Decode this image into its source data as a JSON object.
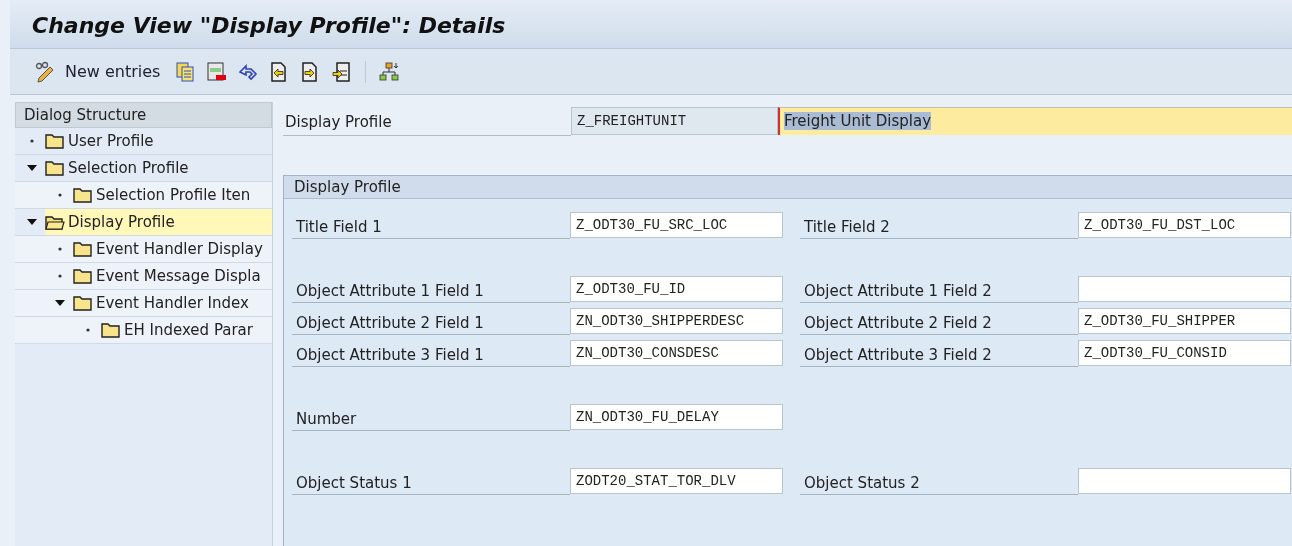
{
  "window": {
    "title": "Change View \"Display Profile\": Details"
  },
  "toolbar": {
    "items": [
      {
        "kind": "glasses-pencil"
      },
      {
        "kind": "text",
        "label": "New entries"
      },
      {
        "kind": "copy"
      },
      {
        "kind": "delete"
      },
      {
        "kind": "undo"
      },
      {
        "kind": "previous"
      },
      {
        "kind": "next"
      },
      {
        "kind": "last"
      },
      {
        "kind": "separator"
      },
      {
        "kind": "hierarchy"
      }
    ]
  },
  "dialog_structure": {
    "title": "Dialog Structure",
    "items": [
      {
        "label": "User Profile",
        "selected": false
      },
      {
        "label": "Selection Profile",
        "selected": false,
        "expanded": true,
        "children": [
          {
            "label": "Selection Profile Iten",
            "selected": false
          }
        ]
      },
      {
        "label": "Display Profile",
        "selected": true,
        "expanded": true,
        "children": [
          {
            "label": "Event Handler Display",
            "selected": false
          },
          {
            "label": "Event Message Displa",
            "selected": false
          },
          {
            "label": "Event Handler Index",
            "selected": false,
            "expanded": true,
            "children": [
              {
                "label": "EH Indexed Parar",
                "selected": false
              }
            ]
          }
        ]
      }
    ]
  },
  "header": {
    "label": "Display Profile",
    "key": "Z_FREIGHTUNIT",
    "description": "Freight Unit Display"
  },
  "section": {
    "title": "Display Profile",
    "groups": [
      [
        [
          {
            "label": "Title Field 1",
            "value": "Z_ODT30_FU_SRC_LOC"
          },
          {
            "label": "Title Field 2",
            "value": "Z_ODT30_FU_DST_LOC"
          }
        ]
      ],
      [
        [
          {
            "label": "Object Attribute 1 Field 1",
            "value": "Z_ODT30_FU_ID"
          },
          {
            "label": "Object Attribute 1 Field 2"
          }
        ],
        [
          {
            "label": "Object Attribute 2 Field 1",
            "value": "ZN_ODT30_SHIPPERDESC"
          },
          {
            "label": "Object Attribute 2 Field 2",
            "value": "Z_ODT30_FU_SHIPPER"
          }
        ],
        [
          {
            "label": "Object Attribute 3 Field 1",
            "value": "ZN_ODT30_CONSDESC"
          },
          {
            "label": "Object Attribute 3 Field 2",
            "value": "Z_ODT30_FU_CONSID"
          }
        ]
      ],
      [
        [
          {
            "label": "Number",
            "value": "ZN_ODT30_FU_DELAY"
          }
        ]
      ],
      [
        [
          {
            "label": "Object Status 1",
            "value": "ZODT20_STAT_TOR_DLV"
          },
          {
            "label": "Object Status 2"
          }
        ]
      ]
    ]
  }
}
